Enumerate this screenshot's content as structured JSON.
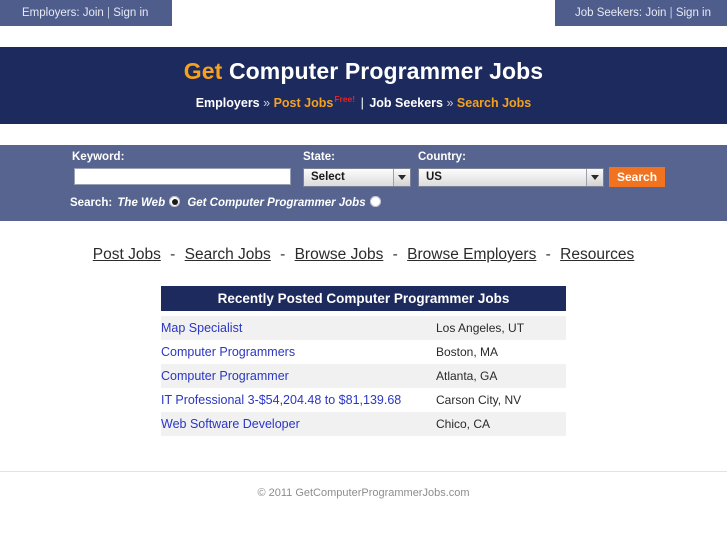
{
  "topbar": {
    "employers": {
      "prefix": "Employers:",
      "join": "Join",
      "separator": "|",
      "signin": "Sign in"
    },
    "jobseekers": {
      "prefix": "Job Seekers:",
      "join": "Join",
      "separator": "|",
      "signin": "Sign in"
    }
  },
  "masthead": {
    "title_accent": "Get",
    "title_rest": " Computer Programmer Jobs",
    "tagline": {
      "employers": "Employers",
      "chevron1": "»",
      "post_jobs": "Post Jobs",
      "free": "Free!",
      "pipe": "|",
      "jobseekers": "Job Seekers",
      "chevron2": "»",
      "search_jobs": "Search Jobs"
    }
  },
  "search": {
    "keyword_label": "Keyword:",
    "keyword_value": "",
    "keyword_placeholder": "",
    "state_label": "State:",
    "state_value": "Select",
    "country_label": "Country:",
    "country_value": "US",
    "search_button": "Search",
    "scope_label": "Search:",
    "scope_web": "The Web",
    "scope_site": "Get Computer Programmer Jobs",
    "scope_selected": "The Web"
  },
  "mainnav": {
    "separator": "-",
    "items": [
      {
        "label": "Post Jobs"
      },
      {
        "label": "Search Jobs"
      },
      {
        "label": "Browse Jobs"
      },
      {
        "label": "Browse Employers"
      },
      {
        "label": "Resources"
      }
    ]
  },
  "jobs_panel": {
    "heading": "Recently Posted Computer Programmer Jobs",
    "rows": [
      {
        "title": "Map Specialist",
        "location": "Los Angeles, UT"
      },
      {
        "title": "Computer Programmers",
        "location": "Boston, MA"
      },
      {
        "title": "Computer Programmer",
        "location": "Atlanta, GA"
      },
      {
        "title": "IT Professional 3-$54,204.48 to $81,139.68",
        "location": "Carson City, NV"
      },
      {
        "title": "Web Software Developer",
        "location": "Chico, CA"
      }
    ]
  },
  "footer": {
    "copyright": "© 2011 GetComputerProgrammerJobs.com"
  },
  "colors": {
    "navy": "#1c2a5e",
    "slate": "#56648f",
    "chip": "#4f5d8c",
    "orange_accent": "#f5a21e",
    "orange_button": "#f1731f",
    "link_blue": "#2b36c4",
    "free_red": "#ef2020"
  }
}
